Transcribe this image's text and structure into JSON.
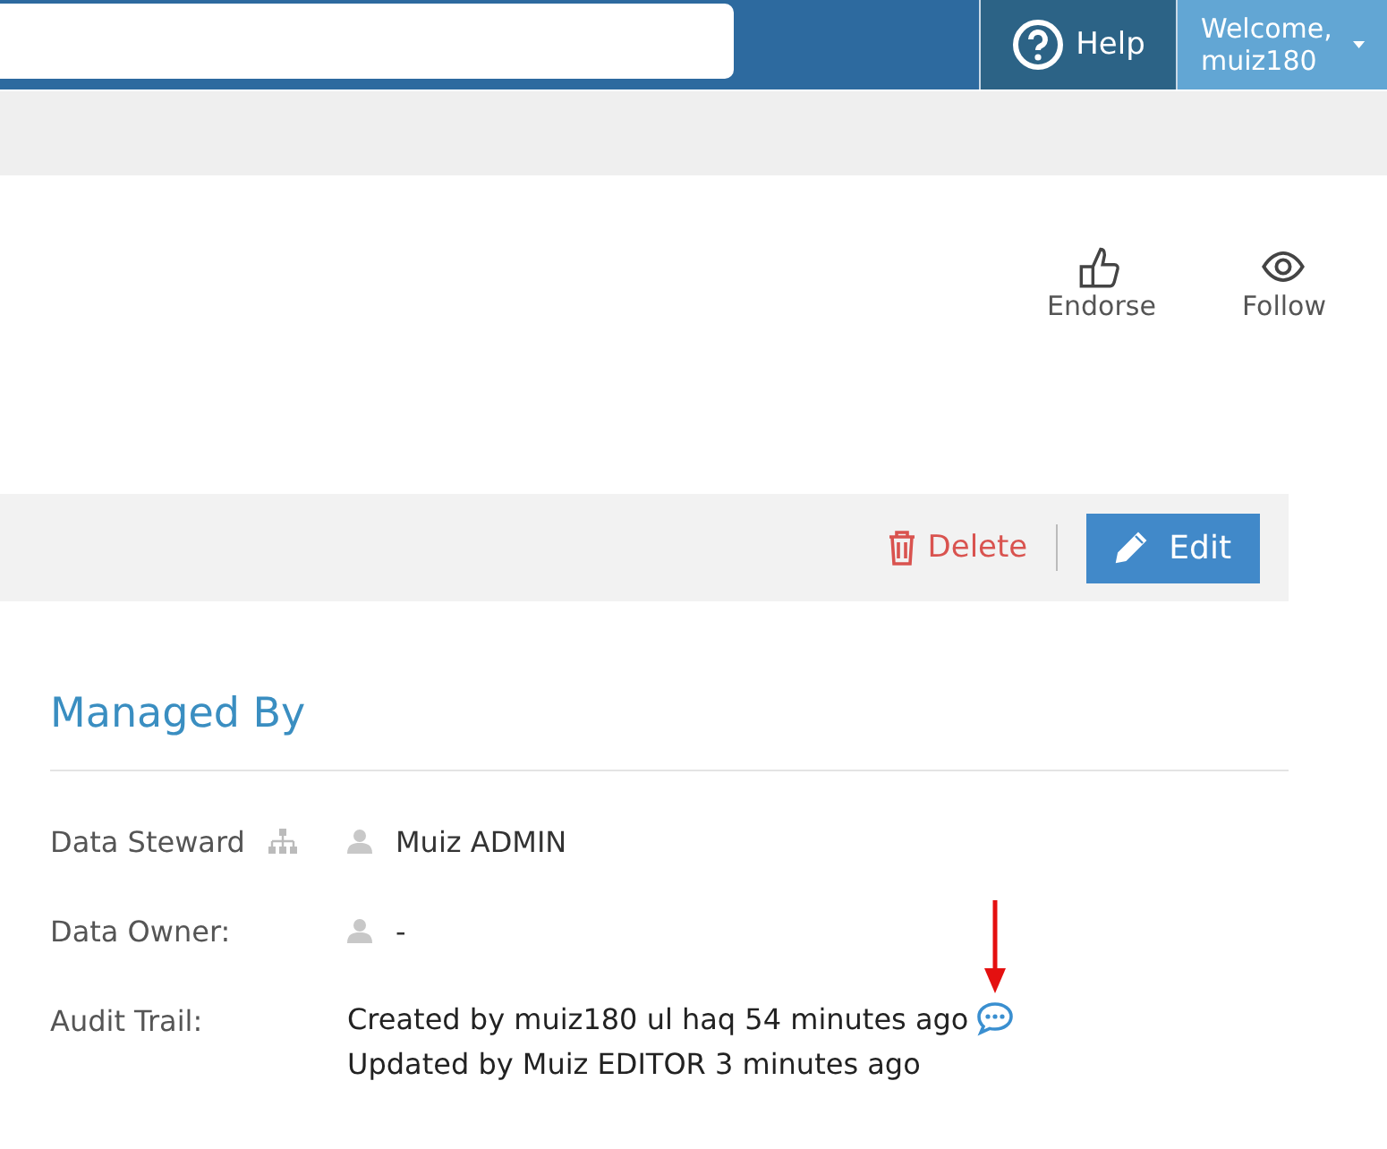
{
  "header": {
    "help": "Help",
    "user": "Welcome, muiz180"
  },
  "actions": [
    {
      "kind": "endorse",
      "label": "Endorse"
    },
    {
      "kind": "follow",
      "label": "Follow"
    }
  ],
  "toolbar": {
    "delete": "Delete",
    "edit": "Edit"
  },
  "managed_by": {
    "title": "Managed By",
    "rows": [
      {
        "kind": "person",
        "label": "Data Steward",
        "hierarchy": true,
        "values": [
          "Muiz ADMIN"
        ]
      },
      {
        "kind": "person",
        "label": "Data Owner:",
        "hierarchy": false,
        "values": [
          "-"
        ]
      },
      {
        "kind": "audit",
        "label": "Audit Trail:",
        "values": [
          "Created by muiz180 ul haq 54 minutes ago",
          "Updated by Muiz EDITOR 3 minutes ago"
        ]
      }
    ]
  }
}
